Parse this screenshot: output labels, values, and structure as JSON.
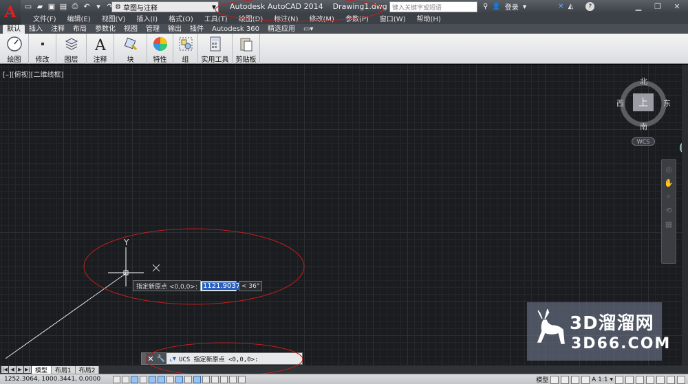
{
  "title_bar": {
    "logo": "A",
    "workspace": "草图与注释",
    "app_name": "Autodesk AutoCAD 2014",
    "document": "Drawing1.dwg",
    "search_placeholder": "键入关键字或短语",
    "signin": "登录",
    "help": "?"
  },
  "menu": [
    "文件(F)",
    "编辑(E)",
    "视图(V)",
    "插入(I)",
    "格式(O)",
    "工具(T)",
    "绘图(D)",
    "标注(N)",
    "修改(M)",
    "参数(P)",
    "窗口(W)",
    "帮助(H)"
  ],
  "ribbon_tabs": [
    "默认",
    "插入",
    "注释",
    "布局",
    "参数化",
    "视图",
    "管理",
    "输出",
    "插件",
    "Autodesk 360",
    "精选应用"
  ],
  "ribbon_panels": [
    {
      "label": "绘图",
      "icon": "draw-icon"
    },
    {
      "label": "修改",
      "icon": "modify-icon"
    },
    {
      "label": "图层",
      "icon": "layers-icon"
    },
    {
      "label": "注释",
      "icon": "annotation-icon"
    },
    {
      "label": "块",
      "icon": "block-icon"
    },
    {
      "label": "特性",
      "icon": "properties-icon"
    },
    {
      "label": "组",
      "icon": "group-icon"
    },
    {
      "label": "实用工具",
      "icon": "utilities-icon"
    },
    {
      "label": "剪贴板",
      "icon": "clipboard-icon"
    }
  ],
  "viewport": {
    "label": "[–][俯视][二维线框]"
  },
  "viewcube": {
    "north": "北",
    "south": "南",
    "east": "东",
    "west": "西",
    "top": "上",
    "wcs": "WCS"
  },
  "dynamic_input": {
    "prompt": "指定新原点 <0,0,0>:",
    "value": "1121.9037",
    "angle": "< 36°"
  },
  "ucs_icon": {
    "y_label": "Y"
  },
  "watermark": {
    "line1": "3D溜溜网",
    "line2": "3D66.COM"
  },
  "layout_tabs": [
    "模型",
    "布局1",
    "布局2"
  ],
  "command_line": {
    "text": "UCS 指定新原点 <0,0,0>:"
  },
  "status_bar": {
    "coords": "1252.3064, 1000.3441, 0.0000",
    "model": "模型",
    "scale": "1:1"
  },
  "colors": {
    "annotation_ellipse": "#c0201c",
    "dyn_highlight": "#2b5fbf"
  }
}
